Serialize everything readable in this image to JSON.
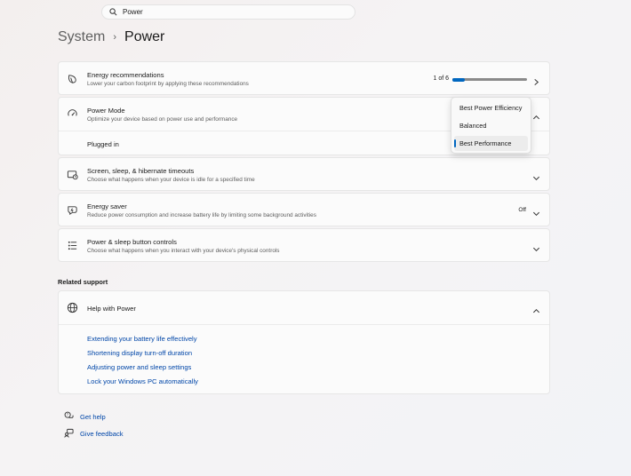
{
  "search": {
    "value": "Power"
  },
  "breadcrumb": {
    "parent": "System",
    "separator": "›",
    "current": "Power"
  },
  "energy_recommendations": {
    "title": "Energy recommendations",
    "description": "Lower your carbon footprint by applying these recommendations",
    "progress_text": "1 of 6",
    "progress_value": 0.17
  },
  "power_mode": {
    "title": "Power Mode",
    "description": "Optimize your device based on power use and performance",
    "plugged_in_label": "Plugged in",
    "options": [
      "Best Power Efficiency",
      "Balanced",
      "Best Performance"
    ],
    "selected": "Best Performance"
  },
  "screen_sleep": {
    "title": "Screen, sleep, & hibernate timeouts",
    "description": "Choose what happens when your device is idle for a specified time"
  },
  "energy_saver": {
    "title": "Energy saver",
    "description": "Reduce power consumption and increase battery life by limiting some background activities",
    "status": "Off"
  },
  "power_buttons": {
    "title": "Power & sleep button controls",
    "description": "Choose what happens when you interact with your device's physical controls"
  },
  "related_support": {
    "heading": "Related support",
    "help_title": "Help with Power",
    "links": [
      "Extending your battery life effectively",
      "Shortening display turn-off duration",
      "Adjusting power and sleep settings",
      "Lock your Windows PC automatically"
    ]
  },
  "footer": {
    "get_help": "Get help",
    "give_feedback": "Give feedback"
  },
  "colors": {
    "accent": "#0067c0",
    "link": "#0046a8"
  }
}
